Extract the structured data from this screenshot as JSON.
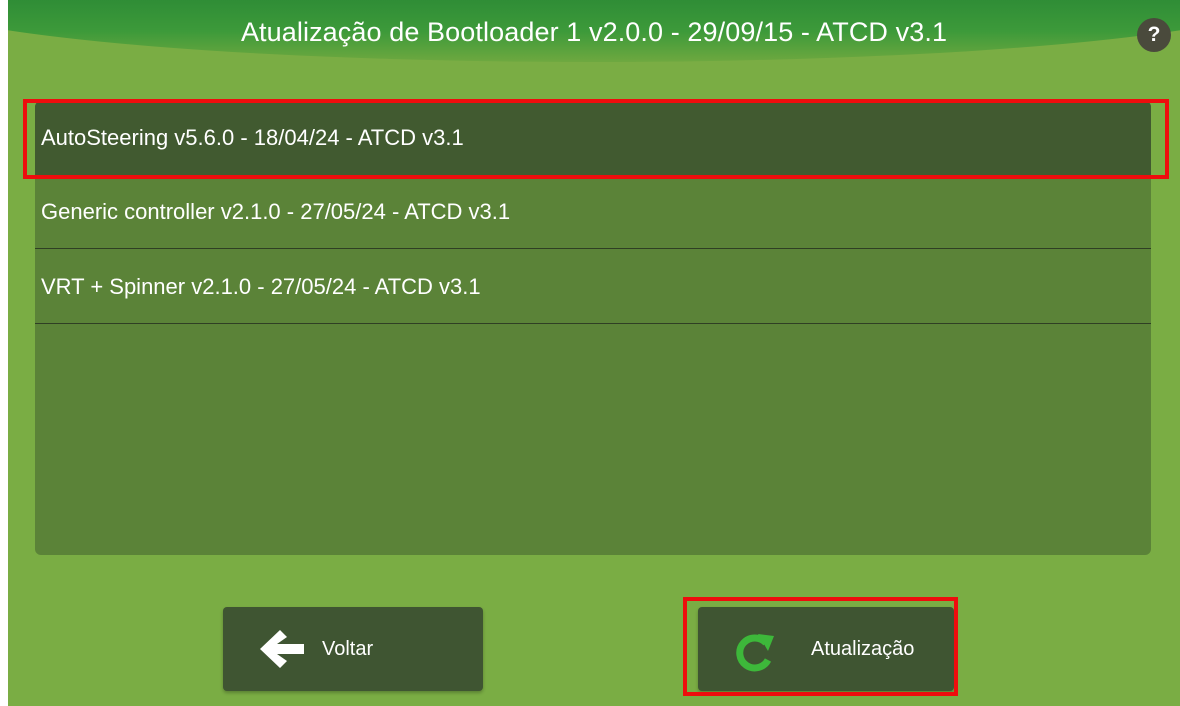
{
  "header": {
    "title": "Atualização de Bootloader 1 v2.0.0 - 29/09/15 - ATCD v3.1",
    "help_label": "?"
  },
  "list": {
    "items": [
      {
        "label": "AutoSteering v5.6.0 - 18/04/24 - ATCD v3.1",
        "selected": true
      },
      {
        "label": "Generic controller v2.1.0 - 27/05/24 - ATCD v3.1",
        "selected": false
      },
      {
        "label": "VRT + Spinner v2.1.0 - 27/05/24 - ATCD v3.1",
        "selected": false
      }
    ]
  },
  "buttons": {
    "back_label": "Voltar",
    "back_icon": "arrow-left-icon",
    "update_label": "Atualização",
    "update_icon": "refresh-icon"
  },
  "colors": {
    "background": "#7aad44",
    "panel": "#5b8338",
    "selected_row": "#415a30",
    "button": "#3f5532",
    "highlight": "#ee0d0d",
    "refresh_icon": "#3db83a"
  }
}
